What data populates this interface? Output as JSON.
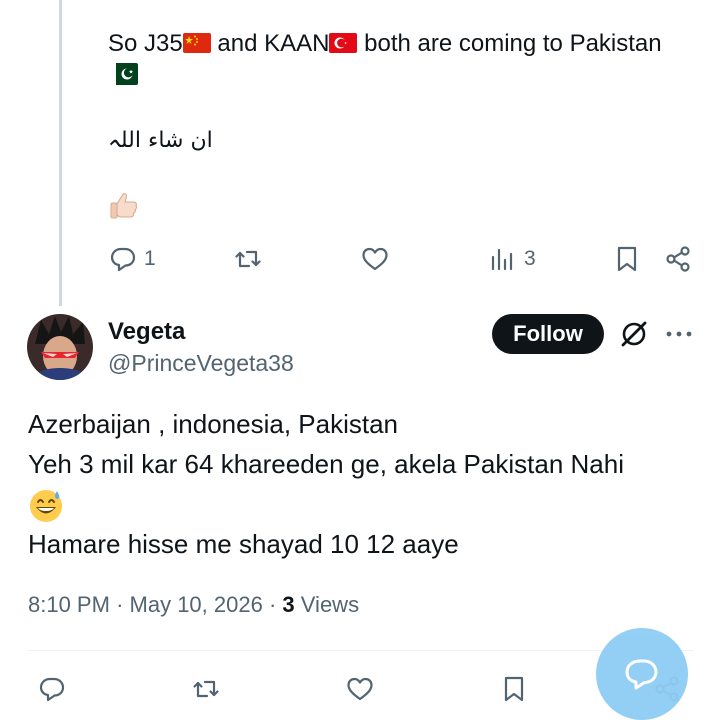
{
  "reply": {
    "line1_a": "So J35",
    "line1_b": " and KAAN",
    "line1_c": " both are coming to Pakistan",
    "urdu": "ان شاء اللہ",
    "reply_count": "1",
    "view_count": "3"
  },
  "tweet": {
    "display_name": "Vegeta",
    "handle": "@PrinceVegeta38",
    "follow_label": "Follow",
    "line1": "Azerbaijan , indonesia, Pakistan",
    "line2": "Yeh 3 mil kar 64 khareeden ge, akela Pakistan Nahi",
    "line4": "Hamare hisse me shayad 10 12 aaye",
    "time": "8:10 PM",
    "date": "May 10, 2026",
    "views_count": "3",
    "views_label": "Views"
  },
  "icons": {
    "reply": "reply-icon",
    "retweet": "retweet-icon",
    "like": "heart-icon",
    "views": "analytics-icon",
    "bookmark": "bookmark-icon",
    "share": "share-icon",
    "grok": "grok-icon",
    "more": "more-icon",
    "fab": "compose-message-icon"
  },
  "colors": {
    "text": "#0f1419",
    "secondary": "#536471",
    "thread_line": "#cfd9de",
    "follow_bg": "#0f1419",
    "fab_bg": "#8ecdf4"
  }
}
